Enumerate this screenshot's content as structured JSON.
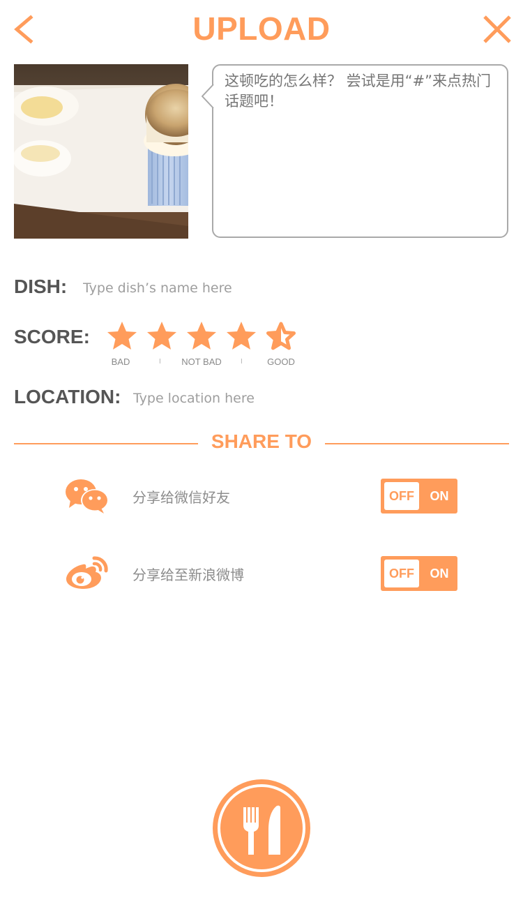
{
  "header": {
    "title": "UPLOAD",
    "back_icon": "chevron-left-icon",
    "close_icon": "close-x-icon"
  },
  "photo": {
    "subject": "souffle dessert photo"
  },
  "comment": {
    "placeholder": "这顿吃的怎么样？ 尝试是用“#”来点热门话题吧！"
  },
  "dish": {
    "label": "DISH:",
    "placeholder": "Type dish’s name here"
  },
  "score": {
    "label": "SCORE:",
    "value": 4.5,
    "max": 5,
    "captions": {
      "bad": "BAD",
      "not_bad": "NOT BAD",
      "good": "GOOD"
    },
    "separators": [
      "I",
      "I"
    ]
  },
  "location": {
    "label": "LOCATION:",
    "placeholder": "Type location here"
  },
  "share": {
    "title": "SHARE TO",
    "items": [
      {
        "icon": "wechat-icon",
        "label": "分享给微信好友",
        "off_label": "OFF",
        "on_label": "ON",
        "state": "off"
      },
      {
        "icon": "weibo-icon",
        "label": "分享给至新浪微博",
        "off_label": "OFF",
        "on_label": "ON",
        "state": "off"
      }
    ]
  },
  "submit": {
    "icon": "fork-knife-icon"
  },
  "colors": {
    "accent": "#ff9c5b",
    "label_text": "#555555",
    "placeholder_text": "#9e9e9e",
    "border": "#a9a9a9"
  }
}
